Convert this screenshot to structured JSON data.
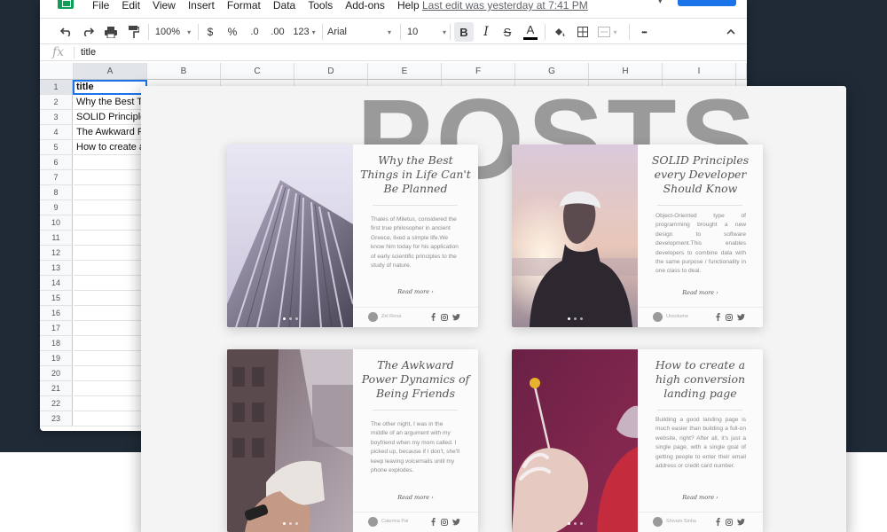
{
  "menu": [
    "File",
    "Edit",
    "View",
    "Insert",
    "Format",
    "Data",
    "Tools",
    "Add-ons",
    "Help"
  ],
  "last_edit": "Last edit was yesterday at 7:41 PM",
  "toolbar": {
    "zoom": "100%",
    "currency": "$",
    "percent": "%",
    "dec_decrease": ".0",
    "dec_increase": ".00",
    "more_formats": "123",
    "font": "Arial",
    "font_size": "10",
    "bold": "B",
    "italic": "I",
    "strike": "S",
    "text_color": "A",
    "more": "•••"
  },
  "formula": {
    "fx": "fx",
    "value": "title"
  },
  "columns": [
    "A",
    "B",
    "C",
    "D",
    "E",
    "F",
    "G",
    "H",
    "I"
  ],
  "rows": [
    "1",
    "2",
    "3",
    "4",
    "5",
    "6",
    "7",
    "8",
    "9",
    "10",
    "11",
    "12",
    "13",
    "14",
    "15",
    "16",
    "17",
    "18",
    "19",
    "20",
    "21",
    "22",
    "23"
  ],
  "cells_col_a": [
    "title",
    "Why the Best T",
    "SOLID Principle",
    "The Awkward P",
    "How to create a"
  ],
  "preview": {
    "heading": "POSTS",
    "posts": [
      {
        "title": "Why the Best Things in Life Can't Be Planned",
        "excerpt": "Thales of Miletus, considered the first true philosopher in ancient Greece, lived a simple life.We know him today for his application of early scientific principles to the study of nature.",
        "read_more": "Read more ›",
        "author": "Zel Rena"
      },
      {
        "title": "SOLID Principles every Developer Should Know",
        "excerpt": "Object-Oriented type of programming brought a new design to software development.This enables developers to combine data with the same purpose / functionality in one class to deal.",
        "read_more": "Read more ›",
        "author": "Unsotume"
      },
      {
        "title": "The Awkward Power Dynamics of Being Friends",
        "excerpt": "The other night, I was in the middle of an argument with my boyfriend when my mom called. I picked up, because if I don't, she'll keep leaving voicemails until my phone explodes.",
        "read_more": "Read more ›",
        "author": "Caterina Pal"
      },
      {
        "title": "How to create a high conversion landing page",
        "excerpt": "Building a good landing page is much easier than building a full-on website, right? After all, it's just a single page, with a single goal of getting people to enter their email address or credit card number.",
        "read_more": "Read more ›",
        "author": "Shivam Sinha"
      }
    ]
  },
  "colors": {
    "sheets_green": "#0f9d58",
    "share_blue": "#1a73e8",
    "dark_bg": "#1f2a36",
    "posts_gray": "#9a9a9a"
  }
}
